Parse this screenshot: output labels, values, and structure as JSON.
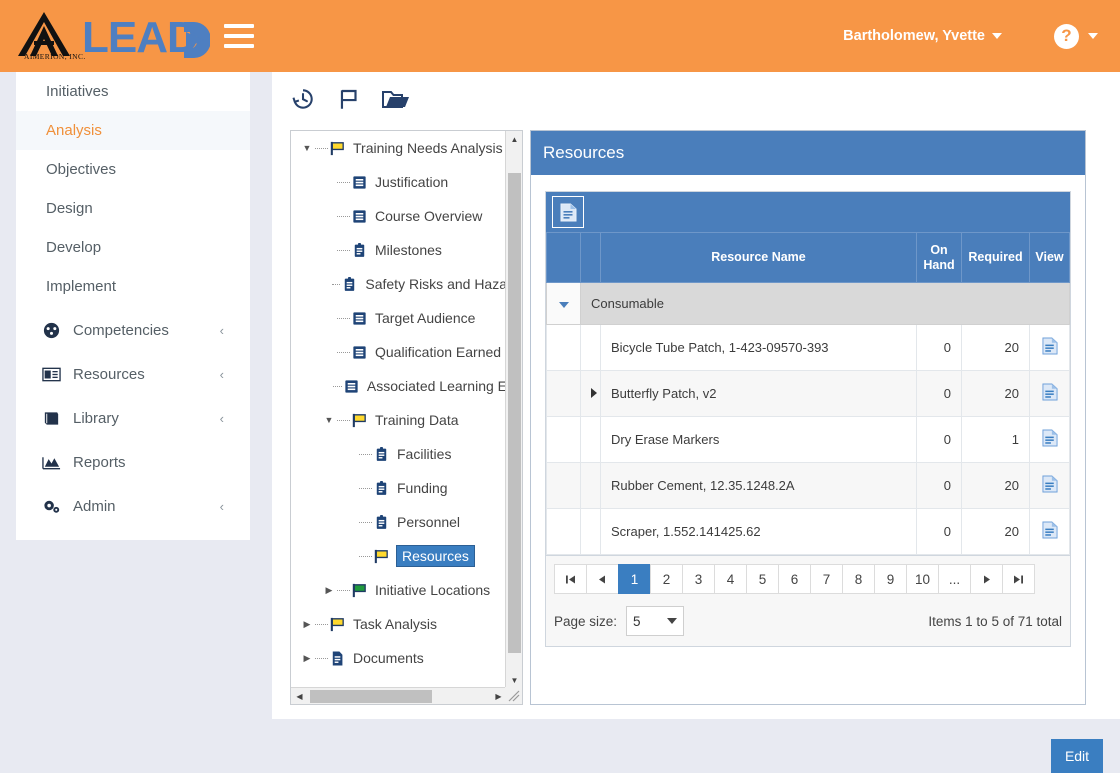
{
  "brand": {
    "company": "AIMERION, INC.",
    "product": "LEAD",
    "accent_orange": "#f79646",
    "accent_blue": "#4a7ebb",
    "logo_blue": "#4e7fc1"
  },
  "topbar": {
    "menu_icon": "hamburger-icon",
    "user_name": "Bartholomew, Yvette",
    "user_caret": "chevron-down-icon",
    "help_label": "?",
    "help_caret": "chevron-down-icon"
  },
  "sidebar": {
    "items": [
      {
        "label": "Initiatives",
        "type": "sub",
        "active": false,
        "icon": null,
        "chevron": false
      },
      {
        "label": "Analysis",
        "type": "sub",
        "active": true,
        "icon": null,
        "chevron": false
      },
      {
        "label": "Objectives",
        "type": "sub",
        "active": false,
        "icon": null,
        "chevron": false
      },
      {
        "label": "Design",
        "type": "sub",
        "active": false,
        "icon": null,
        "chevron": false
      },
      {
        "label": "Develop",
        "type": "sub",
        "active": false,
        "icon": null,
        "chevron": false
      },
      {
        "label": "Implement",
        "type": "sub",
        "active": false,
        "icon": null,
        "chevron": false
      },
      {
        "label": "Competencies",
        "type": "grp",
        "active": false,
        "icon": "competencies-icon",
        "chevron": true
      },
      {
        "label": "Resources",
        "type": "grp",
        "active": false,
        "icon": "resources-icon",
        "chevron": true
      },
      {
        "label": "Library",
        "type": "grp",
        "active": false,
        "icon": "library-icon",
        "chevron": true
      },
      {
        "label": "Reports",
        "type": "grp",
        "active": false,
        "icon": "reports-icon",
        "chevron": false
      },
      {
        "label": "Admin",
        "type": "grp",
        "active": false,
        "icon": "admin-gear-icon",
        "chevron": true
      }
    ],
    "chevron_glyph": "‹"
  },
  "toolbar": {
    "buttons": [
      {
        "name": "history-icon",
        "title": "History"
      },
      {
        "name": "flag-icon",
        "title": "Flag"
      },
      {
        "name": "folder-icon",
        "title": "Folder"
      }
    ]
  },
  "tree": {
    "nodes": [
      {
        "label": "Training Needs Analysis",
        "depth": 0,
        "icon": "yellow-flag-icon",
        "twisty": "down",
        "selected": false
      },
      {
        "label": "Justification",
        "depth": 1,
        "icon": "document-list-icon",
        "twisty": "",
        "selected": false
      },
      {
        "label": "Course Overview",
        "depth": 1,
        "icon": "document-list-icon",
        "twisty": "",
        "selected": false
      },
      {
        "label": "Milestones",
        "depth": 1,
        "icon": "clipboard-icon",
        "twisty": "",
        "selected": false
      },
      {
        "label": "Safety Risks and Haza",
        "depth": 1,
        "icon": "clipboard-icon",
        "twisty": "",
        "selected": false
      },
      {
        "label": "Target Audience",
        "depth": 1,
        "icon": "document-list-icon",
        "twisty": "",
        "selected": false
      },
      {
        "label": "Qualification Earned",
        "depth": 1,
        "icon": "document-list-icon",
        "twisty": "",
        "selected": false
      },
      {
        "label": "Associated Learning E",
        "depth": 1,
        "icon": "document-list-icon",
        "twisty": "",
        "selected": false
      },
      {
        "label": "Training Data",
        "depth": 1,
        "icon": "yellow-flag-icon",
        "twisty": "down",
        "selected": false
      },
      {
        "label": "Facilities",
        "depth": 2,
        "icon": "clipboard-icon",
        "twisty": "",
        "selected": false
      },
      {
        "label": "Funding",
        "depth": 2,
        "icon": "clipboard-icon",
        "twisty": "",
        "selected": false
      },
      {
        "label": "Personnel",
        "depth": 2,
        "icon": "clipboard-icon",
        "twisty": "",
        "selected": false
      },
      {
        "label": "Resources",
        "depth": 2,
        "icon": "yellow-flag-icon",
        "twisty": "",
        "selected": true
      },
      {
        "label": "Initiative Locations",
        "depth": 1,
        "icon": "green-flag-icon",
        "twisty": "right",
        "selected": false
      },
      {
        "label": "Task Analysis",
        "depth": 0,
        "icon": "yellow-flag-icon",
        "twisty": "right",
        "selected": false
      },
      {
        "label": "Documents",
        "depth": 0,
        "icon": "document-icon",
        "twisty": "right",
        "selected": false
      }
    ]
  },
  "resources_panel": {
    "title": "Resources",
    "export_icon": "export-document-icon",
    "columns": [
      "",
      "",
      "Resource Name",
      "On Hand",
      "Required",
      "View"
    ],
    "group_row": {
      "label": "Consumable",
      "expanded": true
    },
    "rows": [
      {
        "expander": false,
        "name": "Bicycle Tube Patch, 1-423-09570-393",
        "on_hand": "0",
        "required": "20",
        "view_icon": "view-document-icon"
      },
      {
        "expander": true,
        "name": "Butterfly Patch, v2",
        "on_hand": "0",
        "required": "20",
        "view_icon": "view-document-icon"
      },
      {
        "expander": false,
        "name": "Dry Erase Markers",
        "on_hand": "0",
        "required": "1",
        "view_icon": "view-document-icon"
      },
      {
        "expander": false,
        "name": "Rubber Cement, 12.35.1248.2A",
        "on_hand": "0",
        "required": "20",
        "view_icon": "view-document-icon"
      },
      {
        "expander": false,
        "name": "Scraper, 1.552.141425.62",
        "on_hand": "0",
        "required": "20",
        "view_icon": "view-document-icon"
      }
    ],
    "pager": {
      "first": "⏮",
      "prev": "◀",
      "pages": [
        "1",
        "2",
        "3",
        "4",
        "5",
        "6",
        "7",
        "8",
        "9",
        "10",
        "..."
      ],
      "current": "1",
      "next": "▶",
      "last": "⏭",
      "page_size_label": "Page size:",
      "page_size_value": "5",
      "items_total": "Items 1 to 5 of 71 total"
    }
  },
  "footer": {
    "edit_label": "Edit"
  }
}
